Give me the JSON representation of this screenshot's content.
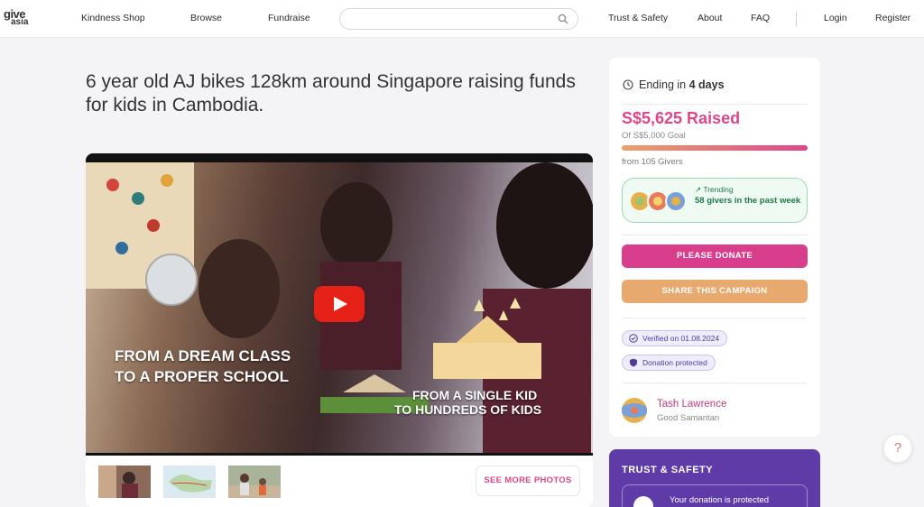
{
  "nav": {
    "logo_top": "give",
    "logo_bottom": "asia",
    "links": [
      "Kindness Shop",
      "Browse",
      "Fundraise"
    ],
    "search_placeholder": "",
    "right_links": [
      "Trust & Safety",
      "About",
      "FAQ"
    ],
    "login": "Login",
    "register": "Register"
  },
  "campaign": {
    "title": "6 year old AJ bikes 128km around Singapore raising funds for kids in Cambodia."
  },
  "video": {
    "overlay_left_line1": "FROM A DREAM CLASS",
    "overlay_left_line2": "TO A PROPER SCHOOL",
    "overlay_right_line1": "FROM A SINGLE KID",
    "overlay_right_line2": "TO HUNDREDS OF KIDS"
  },
  "photos": {
    "see_more": "SEE MORE PHOTOS"
  },
  "sidebar": {
    "ending_prefix": "Ending in",
    "ending_value": "4 days",
    "raised": "S$5,625 Raised",
    "goal": "Of S$5,000 Goal",
    "progress_fraction": 1.0,
    "givers": "from 105 Givers",
    "trending_label": "Trending",
    "trending_text": "58 givers in the past week",
    "donate_button": "PLEASE DONATE",
    "share_button": "SHARE THIS CAMPAIGN",
    "verified": "Verified on 01.08.2024",
    "protected": "Donation protected",
    "organizer_name": "Tash Lawrence",
    "organizer_role": "Good Samaritan"
  },
  "trust": {
    "heading": "TRUST & SAFETY",
    "item": "Your donation is protected"
  },
  "help": {
    "label": "?"
  },
  "colors": {
    "brand_pink": "#e0458a",
    "share_orange": "#e8a96f",
    "trust_purple": "#5f3ba8",
    "trend_green": "#1f7a47"
  }
}
